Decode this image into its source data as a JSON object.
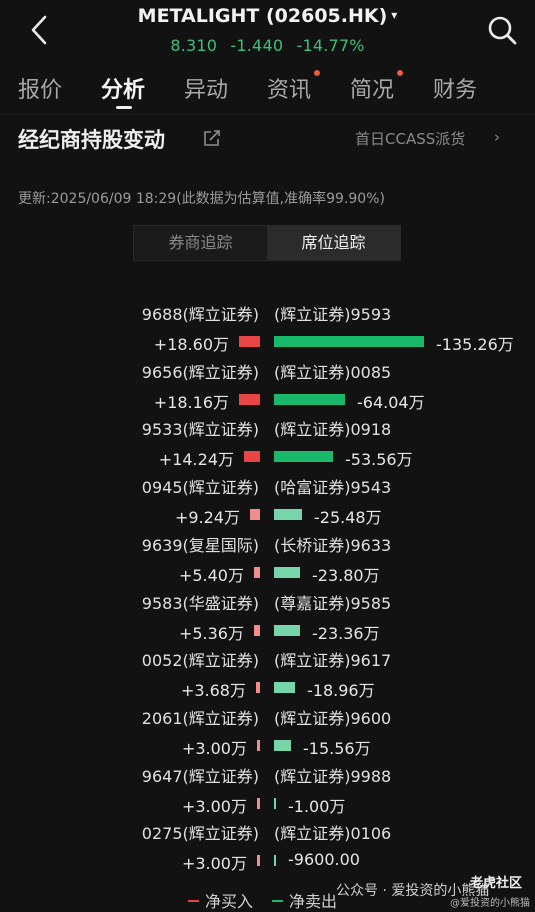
{
  "header": {
    "title": "METALIGHT (02605.HK)",
    "title_caret": "▾",
    "price": "8.310",
    "change": "-1.440",
    "change_pct": "-14.77%",
    "quote_color": "#3cc07a"
  },
  "tabs": [
    {
      "label": "报价",
      "active": false,
      "dot": false
    },
    {
      "label": "分析",
      "active": true,
      "dot": false
    },
    {
      "label": "异动",
      "active": false,
      "dot": false
    },
    {
      "label": "资讯",
      "active": false,
      "dot": true
    },
    {
      "label": "简况",
      "active": false,
      "dot": true
    },
    {
      "label": "财务",
      "active": false,
      "dot": false
    }
  ],
  "section": {
    "title": "经纪商持股变动",
    "ccass_link": "首日CCASS派货",
    "ccass_chevron": "›",
    "update_text": "更新:2025/06/09 18:29(此数据为估算值,准确率99.90%)"
  },
  "segment": {
    "items": [
      "券商追踪",
      "席位追踪"
    ],
    "selected": "席位追踪"
  },
  "colors": {
    "buy": "#e84545",
    "buy_light": "#f28b8b",
    "sell": "#19b86a",
    "sell_light": "#76d6aa"
  },
  "rows": [
    {
      "buyer": "9688(辉立证券)",
      "buy_value": "+18.60万",
      "buy_wan": 18.6,
      "seller": "(辉立证券)9593",
      "sell_value": "-135.26万",
      "sell_wan": 135.26
    },
    {
      "buyer": "9656(辉立证券)",
      "buy_value": "+18.16万",
      "buy_wan": 18.16,
      "seller": "(辉立证券)0085",
      "sell_value": "-64.04万",
      "sell_wan": 64.04
    },
    {
      "buyer": "9533(辉立证券)",
      "buy_value": "+14.24万",
      "buy_wan": 14.24,
      "seller": "(辉立证券)0918",
      "sell_value": "-53.56万",
      "sell_wan": 53.56
    },
    {
      "buyer": "0945(辉立证券)",
      "buy_value": "+9.24万",
      "buy_wan": 9.24,
      "seller": "(哈富证券)9543",
      "sell_value": "-25.48万",
      "sell_wan": 25.48
    },
    {
      "buyer": "9639(复星国际)",
      "buy_value": "+5.40万",
      "buy_wan": 5.4,
      "seller": "(长桥证券)9633",
      "sell_value": "-23.80万",
      "sell_wan": 23.8
    },
    {
      "buyer": "9583(华盛证券)",
      "buy_value": "+5.36万",
      "buy_wan": 5.36,
      "seller": "(尊嘉证券)9585",
      "sell_value": "-23.36万",
      "sell_wan": 23.36
    },
    {
      "buyer": "0052(辉立证券)",
      "buy_value": "+3.68万",
      "buy_wan": 3.68,
      "seller": "(辉立证券)9617",
      "sell_value": "-18.96万",
      "sell_wan": 18.96
    },
    {
      "buyer": "2061(辉立证券)",
      "buy_value": "+3.00万",
      "buy_wan": 3.0,
      "seller": "(辉立证券)9600",
      "sell_value": "-15.56万",
      "sell_wan": 15.56
    },
    {
      "buyer": "9647(辉立证券)",
      "buy_value": "+3.00万",
      "buy_wan": 3.0,
      "seller": "(辉立证券)9988",
      "sell_value": "-1.00万",
      "sell_wan": 1.0
    },
    {
      "buyer": "0275(辉立证券)",
      "buy_value": "+3.00万",
      "buy_wan": 3.0,
      "seller": "(辉立证券)0106",
      "sell_value": "-9600.00",
      "sell_wan": 0.96
    }
  ],
  "legend": {
    "buy": "净买入",
    "sell": "净卖出"
  },
  "watermark": {
    "wechat": "公众号 · 爱投资的小熊猫",
    "community": "老虎社区",
    "handle": "@爱投资的小熊猫"
  }
}
